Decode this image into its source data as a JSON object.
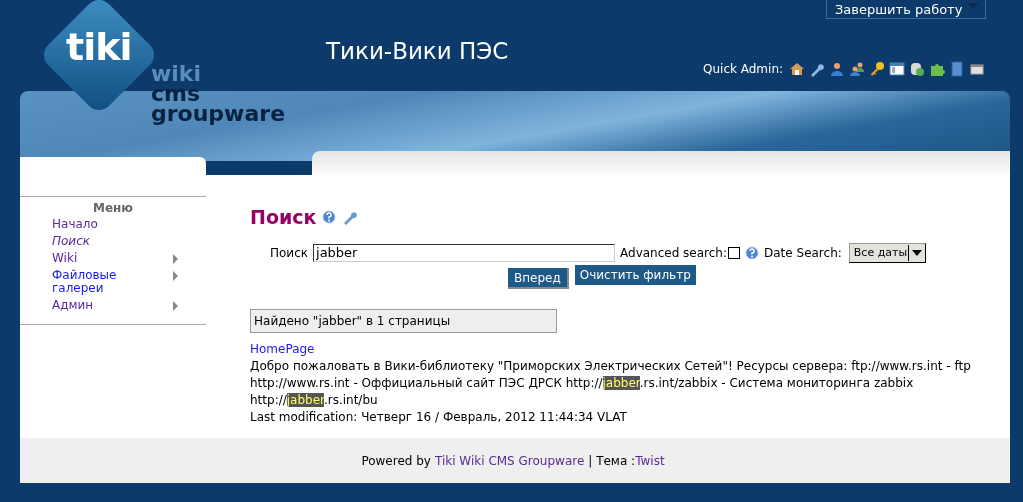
{
  "top_bar": {
    "logout_button": "Завершить работу"
  },
  "header": {
    "site_title": "Тики-Вики ПЭС",
    "logo_text": "tiki",
    "logo_tagline": [
      "wiki",
      "cms",
      "groupware"
    ],
    "quick_admin_label": "Quick Admin:"
  },
  "sidebar": {
    "title": "Меню",
    "items": [
      {
        "label": "Начало",
        "selected": false,
        "visited": true,
        "has_submenu": false
      },
      {
        "label": "Поиск",
        "selected": true,
        "visited": true,
        "has_submenu": false
      },
      {
        "label": "Wiki",
        "selected": false,
        "visited": true,
        "has_submenu": true
      },
      {
        "label": "Файловые галереи",
        "selected": false,
        "visited": false,
        "has_submenu": true
      },
      {
        "label": "Админ",
        "selected": false,
        "visited": true,
        "has_submenu": true
      }
    ]
  },
  "main": {
    "title": "Поиск",
    "search_form": {
      "label": "Поиск",
      "value": "jabber",
      "advanced_label": "Advanced search:",
      "advanced_checked": false,
      "date_label": "Date Search:",
      "date_value": "Все даты",
      "submit_button": "Вперед",
      "clear_button": "Очистить фильтр"
    },
    "result_summary": "Найдено \"jabber\" в 1 страницы",
    "results": [
      {
        "title": "HomePage",
        "snippet": [
          {
            "text": "Добро пожаловать в Вики-библиотеку \"Приморских Электрических Сетей\"! Ресурсы сервера: ftp://www.rs.int - ftp http://www.rs.int - Оффициальный сайт ПЭС ДРСК http://",
            "highlight": false
          },
          {
            "text": "jabber",
            "highlight": true
          },
          {
            "text": ".rs.int/zabbix - Система мониторинга zabbix http://",
            "highlight": false
          },
          {
            "text": "jabber",
            "highlight": true
          },
          {
            "text": ".rs.int/bu",
            "highlight": false
          }
        ],
        "modified": "Last modification: Четверг 16 / Февраль, 2012 11:44:34 VLAT"
      }
    ]
  },
  "footer": {
    "powered_by": "Powered by",
    "cms_link": "Tiki Wiki CMS Groupware",
    "separator": "| Тема :",
    "theme_link": "Twist"
  }
}
